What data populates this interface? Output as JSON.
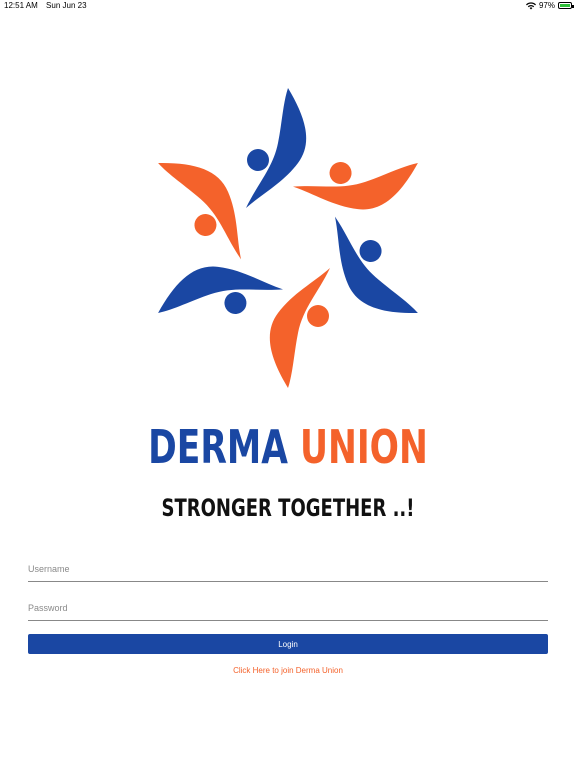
{
  "status_bar": {
    "time": "12:51 AM",
    "date": "Sun Jun 23",
    "battery": "97%",
    "wifi_icon": "wifi-icon",
    "battery_icon": "battery-charging-icon"
  },
  "logo": {
    "icon": "derma-union-logo",
    "colors": {
      "blue": "#1a47a3",
      "orange": "#f4622b"
    }
  },
  "brand": {
    "part1": "DERMA",
    "part2": "UNION"
  },
  "tagline": "STRONGER TOGETHER ..!",
  "form": {
    "username_placeholder": "Username",
    "username_value": "",
    "password_placeholder": "Password",
    "password_value": "",
    "login_label": "Login",
    "join_link": "Click Here to join Derma Union"
  }
}
